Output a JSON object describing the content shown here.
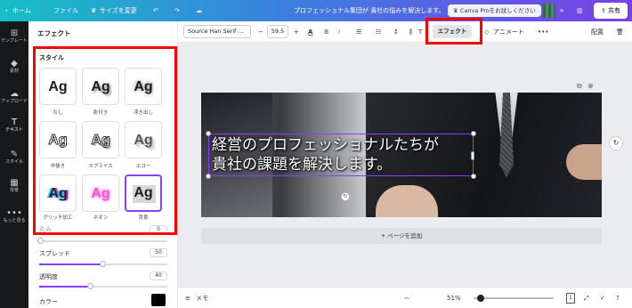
{
  "topbar": {
    "home": "ホーム",
    "file": "ファイル",
    "resize": "サイズを変更",
    "doc_title": "プロフェッショナル集団が 貴社の悩みを解決します。",
    "canva_pro": "Canva Proをお試しください",
    "share": "共有"
  },
  "rail": [
    {
      "icon": "⊞",
      "label": "テンプレート"
    },
    {
      "icon": "◆",
      "label": "素材"
    },
    {
      "icon": "☁",
      "label": "アップロード"
    },
    {
      "icon": "T",
      "label": "テキスト"
    },
    {
      "icon": "✎",
      "label": "スタイル"
    },
    {
      "icon": "▦",
      "label": "背景"
    },
    {
      "icon": "•••",
      "label": "もっと見る"
    }
  ],
  "panel": {
    "title": "エフェクト",
    "style_label": "スタイル",
    "styles": [
      {
        "sample": "Ag",
        "label": "なし"
      },
      {
        "sample": "Ag",
        "label": "影付き"
      },
      {
        "sample": "Ag",
        "label": "浮き出し"
      },
      {
        "sample": "Ag",
        "label": "中抜き"
      },
      {
        "sample": "Ag",
        "label": "スプライス"
      },
      {
        "sample": "Ag",
        "label": "エコー"
      },
      {
        "sample": "Ag",
        "label": "グリッチ加工"
      },
      {
        "sample": "Ag",
        "label": "ネオン"
      },
      {
        "sample": "Ag",
        "label": "背景"
      }
    ],
    "partial_label": "丸み",
    "partial_value": "0",
    "spread_label": "スプレッド",
    "spread_value": "50",
    "transparency_label": "透明度",
    "transparency_value": "40",
    "color_label": "カラー",
    "color_swatch": "#000000"
  },
  "toolbar": {
    "font": "Source Han Serif ...",
    "minus": "−",
    "size": "59.5",
    "plus": "+",
    "effect": "エフェクト",
    "animate": "アニメート",
    "more": "•••",
    "position": "配置"
  },
  "canvas": {
    "headline_line1": "経営のプロフェッショナルたちが",
    "headline_line2": "貴社の課題を解決します。",
    "add_page": "+ ページを追加"
  },
  "bottombar": {
    "notes": "メモ",
    "zoom": "51%",
    "page_count": "1"
  },
  "colors": {
    "accent": "#8b3dff",
    "highlight_box": "#ff0000"
  }
}
